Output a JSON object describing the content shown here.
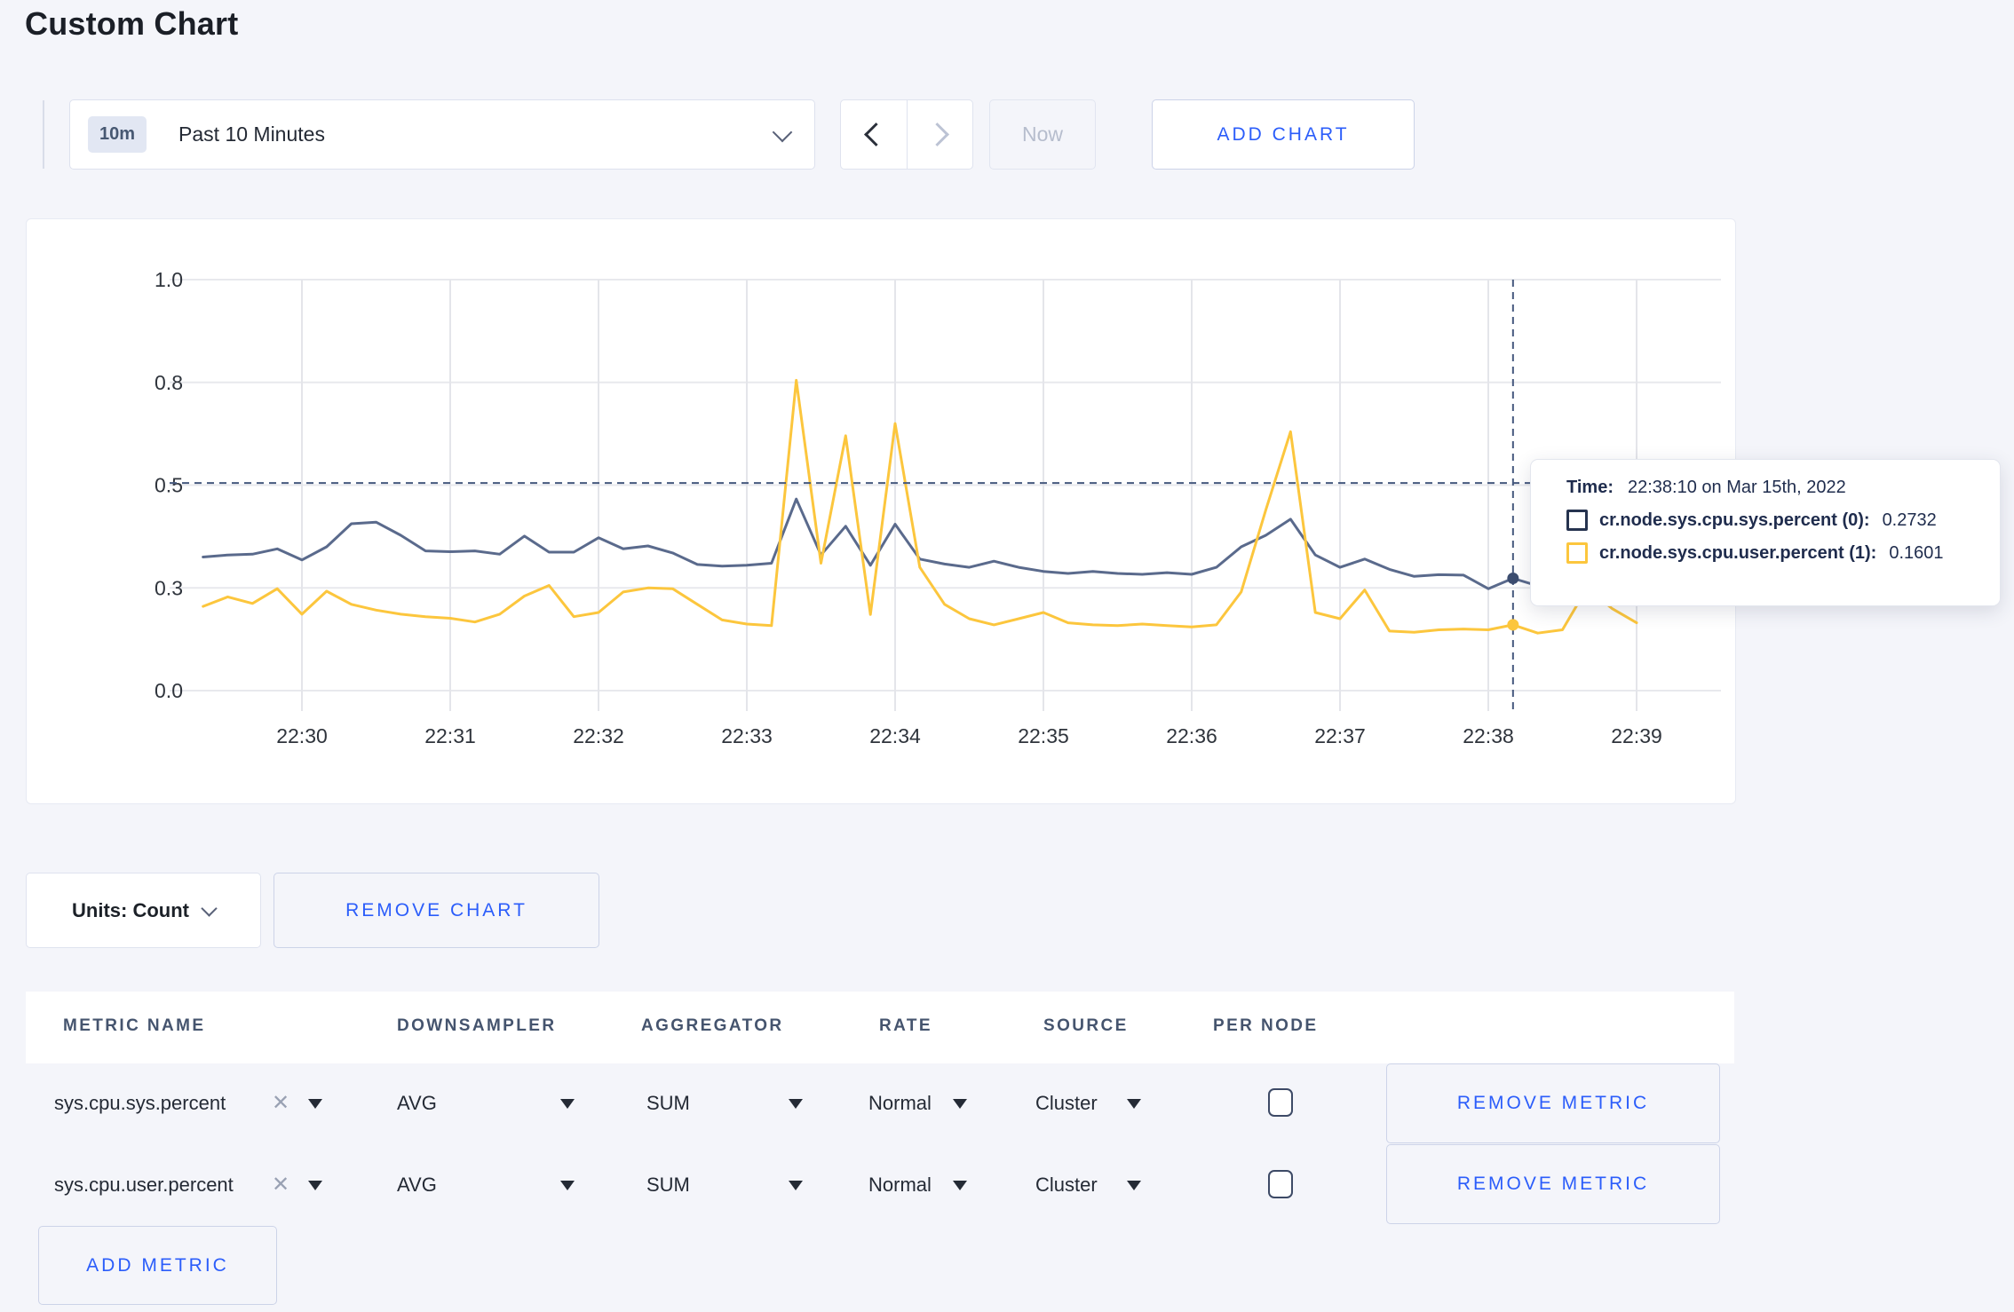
{
  "page": {
    "title": "Custom Chart"
  },
  "toolbar": {
    "range_badge": "10m",
    "range_label": "Past 10 Minutes",
    "now_label": "Now",
    "add_chart_label": "ADD CHART"
  },
  "tooltip": {
    "time_label": "Time:",
    "time_value": "22:38:10 on Mar 15th, 2022",
    "series": [
      {
        "label": "cr.node.sys.cpu.sys.percent (0):",
        "value": "0.2732",
        "color": "#26334f"
      },
      {
        "label": "cr.node.sys.cpu.user.percent (1):",
        "value": "0.1601",
        "color": "#fcc63d"
      }
    ]
  },
  "units_row": {
    "units_label": "Units: Count",
    "remove_chart_label": "REMOVE CHART"
  },
  "metrics_table": {
    "headers": [
      "METRIC NAME",
      "DOWNSAMPLER",
      "AGGREGATOR",
      "RATE",
      "SOURCE",
      "PER NODE"
    ],
    "rows": [
      {
        "metric": "sys.cpu.sys.percent",
        "downsampler": "AVG",
        "aggregator": "SUM",
        "rate": "Normal",
        "source": "Cluster",
        "per_node_checked": false,
        "remove_label": "REMOVE METRIC"
      },
      {
        "metric": "sys.cpu.user.percent",
        "downsampler": "AVG",
        "aggregator": "SUM",
        "rate": "Normal",
        "source": "Cluster",
        "per_node_checked": false,
        "remove_label": "REMOVE METRIC"
      }
    ],
    "add_metric_label": "ADD METRIC"
  },
  "chart_data": {
    "type": "line",
    "title": "",
    "xlabel": "",
    "ylabel": "",
    "ylim": [
      0,
      1
    ],
    "grid": true,
    "legend_position": "tooltip",
    "y_tick_values": [
      0,
      0.25,
      0.5,
      0.75,
      1.0
    ],
    "y_tick_labels": [
      "0.0",
      "0.3",
      "0.5",
      "0.8",
      "1.0"
    ],
    "x_ticks": [
      "22:30",
      "22:31",
      "22:32",
      "22:33",
      "22:34",
      "22:35",
      "22:36",
      "22:37",
      "22:38",
      "22:39"
    ],
    "x_start": "22:29:20",
    "x_step_seconds": 10,
    "series": [
      {
        "name": "cr.node.sys.cpu.sys.percent (0)",
        "color": "#5a6a8c",
        "marker_color": "#3c4d70",
        "values": [
          0.325,
          0.33,
          0.332,
          0.345,
          0.318,
          0.35,
          0.406,
          0.41,
          0.378,
          0.34,
          0.338,
          0.34,
          0.332,
          0.376,
          0.337,
          0.337,
          0.372,
          0.345,
          0.352,
          0.335,
          0.307,
          0.303,
          0.305,
          0.31,
          0.466,
          0.33,
          0.4,
          0.305,
          0.405,
          0.32,
          0.308,
          0.3,
          0.315,
          0.3,
          0.29,
          0.285,
          0.29,
          0.285,
          0.283,
          0.287,
          0.283,
          0.3,
          0.35,
          0.378,
          0.417,
          0.33,
          0.3,
          0.32,
          0.295,
          0.278,
          0.282,
          0.281,
          0.248,
          0.2732,
          0.255,
          0.27,
          0.275,
          0.27,
          0.28
        ]
      },
      {
        "name": "cr.node.sys.cpu.user.percent (1)",
        "color": "#fcc63d",
        "marker_color": "#fcc63d",
        "values": [
          0.205,
          0.228,
          0.212,
          0.248,
          0.186,
          0.242,
          0.21,
          0.196,
          0.186,
          0.18,
          0.176,
          0.167,
          0.186,
          0.23,
          0.256,
          0.18,
          0.19,
          0.24,
          0.25,
          0.248,
          0.21,
          0.172,
          0.162,
          0.158,
          0.755,
          0.31,
          0.62,
          0.185,
          0.65,
          0.3,
          0.21,
          0.175,
          0.16,
          0.175,
          0.19,
          0.165,
          0.16,
          0.158,
          0.162,
          0.158,
          0.155,
          0.16,
          0.24,
          0.44,
          0.63,
          0.19,
          0.175,
          0.245,
          0.145,
          0.142,
          0.148,
          0.15,
          0.148,
          0.1601,
          0.14,
          0.148,
          0.25,
          0.2,
          0.165
        ]
      }
    ],
    "crosshair": {
      "x_time": "22:38:10",
      "y_value": 0.505,
      "markers": [
        {
          "series": 0,
          "value": 0.2732
        },
        {
          "series": 1,
          "value": 0.1601
        }
      ]
    }
  }
}
